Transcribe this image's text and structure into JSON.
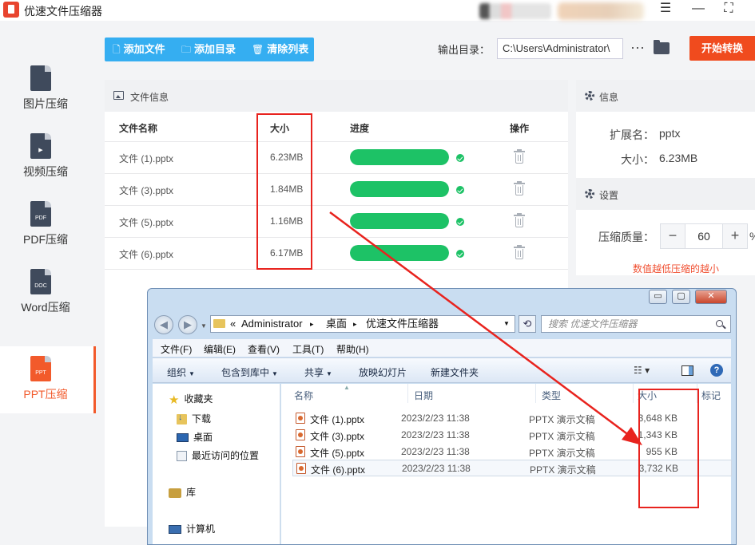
{
  "app": {
    "title": "优速文件压缩器"
  },
  "window_controls": {
    "menu": "☰",
    "minimize": "—",
    "maximize": "⛶"
  },
  "sidebar": {
    "items": [
      {
        "label": "图片压缩",
        "icon_text": "",
        "icon": "image-file-icon"
      },
      {
        "label": "视频压缩",
        "icon_text": "▶",
        "icon": "video-file-icon"
      },
      {
        "label": "PDF压缩",
        "icon_text": "PDF",
        "icon": "pdf-file-icon"
      },
      {
        "label": "Word压缩",
        "icon_text": "DOC",
        "icon": "word-file-icon"
      },
      {
        "label": "PPT压缩",
        "icon_text": "PPT",
        "icon": "ppt-file-icon",
        "active": true
      }
    ]
  },
  "toolbar": {
    "add_file": "添加文件",
    "add_dir": "添加目录",
    "clear_list": "清除列表",
    "output_label": "输出目录：",
    "output_path": "C:\\Users\\Administrator\\",
    "more": "···",
    "start": "开始转换"
  },
  "file_panel": {
    "title": "文件信息",
    "columns": {
      "name": "文件名称",
      "size": "大小",
      "progress": "进度",
      "action": "操作"
    },
    "rows": [
      {
        "name": "文件 (1).pptx",
        "size": "6.23MB",
        "progress": 1.0
      },
      {
        "name": "文件 (3).pptx",
        "size": "1.84MB",
        "progress": 1.0
      },
      {
        "name": "文件 (5).pptx",
        "size": "1.16MB",
        "progress": 1.0
      },
      {
        "name": "文件 (6).pptx",
        "size": "6.17MB",
        "progress": 1.0
      }
    ]
  },
  "info_panel": {
    "title": "信息",
    "ext_label": "扩展名：",
    "ext_value": "pptx",
    "size_label": "大小：",
    "size_value": "6.23MB"
  },
  "settings_panel": {
    "title": "设置",
    "quality_label": "压缩质量：",
    "quality_value": "60",
    "minus": "−",
    "plus": "+",
    "unit": "%",
    "hint": "数值越低压缩的越小"
  },
  "explorer": {
    "controls": {
      "minimize": "▭",
      "maximize": "▢",
      "close": "✕"
    },
    "address": {
      "prefix": "«",
      "crumbs": [
        "Administrator",
        "桌面",
        "优速文件压缩器"
      ],
      "separator": "▸"
    },
    "search_placeholder": "搜索 优速文件压缩器",
    "menu": [
      "文件(F)",
      "编辑(E)",
      "查看(V)",
      "工具(T)",
      "帮助(H)"
    ],
    "commands": [
      "组织",
      "包含到库中",
      "共享",
      "放映幻灯片",
      "新建文件夹"
    ],
    "tree": [
      {
        "label": "收藏夹",
        "icon": "star-icon"
      },
      {
        "label": "下载",
        "icon": "download-folder-icon"
      },
      {
        "label": "桌面",
        "icon": "desktop-icon"
      },
      {
        "label": "最近访问的位置",
        "icon": "recent-places-icon"
      },
      {
        "label": "库",
        "icon": "library-icon"
      },
      {
        "label": "计算机",
        "icon": "computer-icon"
      }
    ],
    "columns": {
      "name": "名称",
      "date": "日期",
      "type": "类型",
      "size": "大小",
      "tag": "标记"
    },
    "files": [
      {
        "name": "文件 (1).pptx",
        "date": "2023/2/23 11:38",
        "type": "PPTX 演示文稿",
        "size": "3,648 KB"
      },
      {
        "name": "文件 (3).pptx",
        "date": "2023/2/23 11:38",
        "type": "PPTX 演示文稿",
        "size": "1,343 KB"
      },
      {
        "name": "文件 (5).pptx",
        "date": "2023/2/23 11:38",
        "type": "PPTX 演示文稿",
        "size": "955 KB"
      },
      {
        "name": "文件 (6).pptx",
        "date": "2023/2/23 11:38",
        "type": "PPTX 演示文稿",
        "size": "3,732 KB",
        "selected": true
      }
    ]
  },
  "colors": {
    "accent": "#f25a2b",
    "toolbar_blue": "#35aef1",
    "progress_green": "#1dc266",
    "annotation_red": "#e8231e"
  }
}
